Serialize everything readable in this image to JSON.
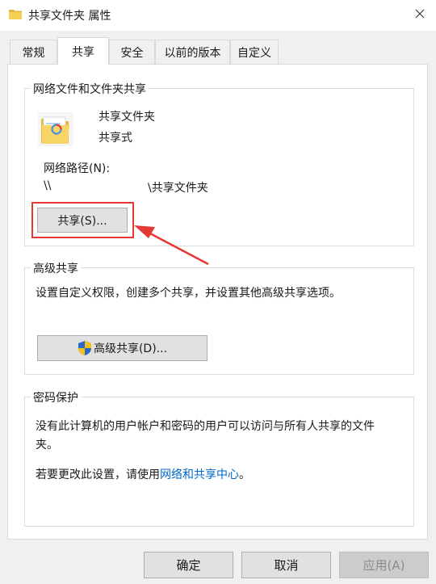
{
  "title_bar": {
    "title": "共享文件夹 属性",
    "folder_icon": "folder-icon",
    "close_icon": "close-icon"
  },
  "tabs": [
    {
      "label": "常规",
      "active": false
    },
    {
      "label": "共享",
      "active": true
    },
    {
      "label": "安全",
      "active": false
    },
    {
      "label": "以前的版本",
      "active": false
    },
    {
      "label": "自定义",
      "active": false
    }
  ],
  "network_share": {
    "group_title": "网络文件和文件夹共享",
    "folder_name": "共享文件夹",
    "share_status": "共享式",
    "path_label": "网络路径(N):",
    "path_value_start": "\\\\",
    "path_value_end": "\\共享文件夹",
    "share_button": "共享(S)..."
  },
  "advanced_share": {
    "group_title": "高级共享",
    "description": "设置自定义权限，创建多个共享，并设置其他高级共享选项。",
    "button": "高级共享(D)...",
    "shield_icon": "shield-icon"
  },
  "password": {
    "group_title": "密码保护",
    "description_line1": "没有此计算机的用户帐户和密码的用户可以访问与所有人共享的文件",
    "description_line2": "夹。",
    "change_prefix": "若要更改此设置，请使用",
    "change_link": "网络和共享中心",
    "change_suffix": "。"
  },
  "buttons": {
    "ok": "确定",
    "cancel": "取消",
    "apply": "应用(A)"
  },
  "colors": {
    "highlight_red": "#e53935",
    "link_blue": "#0066cc"
  }
}
